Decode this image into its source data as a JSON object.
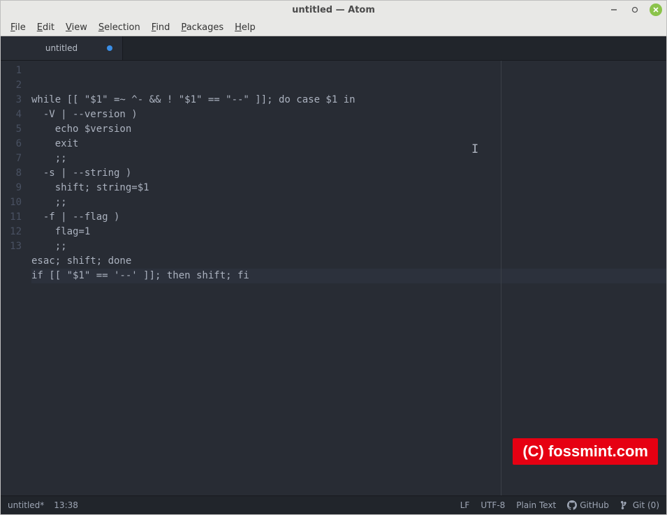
{
  "window": {
    "title": "untitled — Atom"
  },
  "menu": {
    "items": [
      {
        "label": "File",
        "accel": "F"
      },
      {
        "label": "Edit",
        "accel": "E"
      },
      {
        "label": "View",
        "accel": "V"
      },
      {
        "label": "Selection",
        "accel": "S"
      },
      {
        "label": "Find",
        "accel": "F"
      },
      {
        "label": "Packages",
        "accel": "P"
      },
      {
        "label": "Help",
        "accel": "H"
      }
    ]
  },
  "tab": {
    "label": "untitled",
    "modified": true
  },
  "editor": {
    "wrap_guide_col": 80,
    "cursor_line": 13,
    "lines": [
      "while [[ \"$1\" =~ ^- && ! \"$1\" == \"--\" ]]; do case $1 in",
      "  -V | --version )",
      "    echo $version",
      "    exit",
      "    ;;",
      "  -s | --string )",
      "    shift; string=$1",
      "    ;;",
      "  -f | --flag )",
      "    flag=1",
      "    ;;",
      "esac; shift; done",
      "if [[ \"$1\" == '--' ]]; then shift; fi"
    ]
  },
  "status": {
    "filename": "untitled*",
    "cursor_pos": "13:38",
    "line_ending": "LF",
    "encoding": "UTF-8",
    "grammar": "Plain Text",
    "github_label": "GitHub",
    "git_label": "Git (0)"
  },
  "watermark": "(C) fossmint.com"
}
